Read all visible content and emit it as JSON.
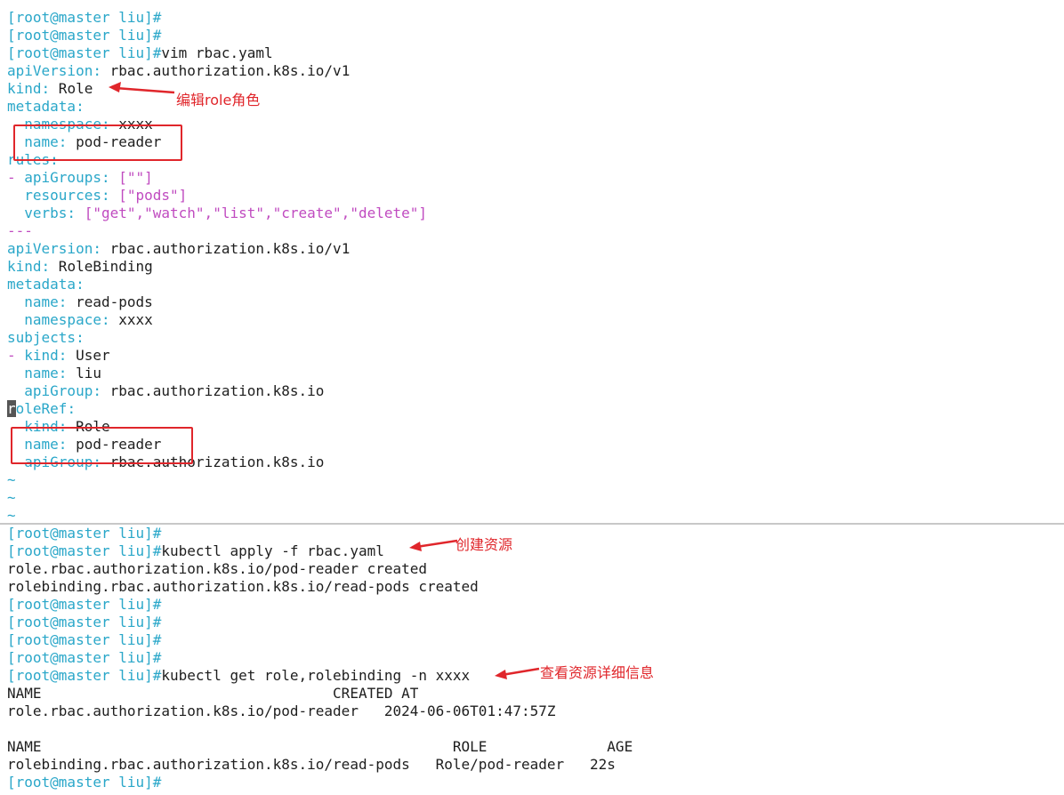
{
  "prompt": "[root@master liu]#",
  "editor": {
    "command": "vim rbac.yaml",
    "lines": {
      "l1_key": "apiVersion:",
      "l1_val": " rbac.authorization.k8s.io/v1",
      "l2_key": "kind:",
      "l2_val": " Role",
      "l3_key": "metadata:",
      "l4_key": "namespace:",
      "l4_val": " xxxx",
      "l5_key": "name:",
      "l5_val": " pod-reader",
      "l6_key": "rules:",
      "l7_dash": "- ",
      "l7_key": "apiGroups:",
      "l7_val": " [\"\"]",
      "l8_key": "resources:",
      "l8_val": " [\"pods\"]",
      "l9_key": "verbs:",
      "l9_val": " [\"get\",\"watch\",\"list\",\"create\",\"delete\"]",
      "l10": "---",
      "l11_key": "apiVersion:",
      "l11_val": " rbac.authorization.k8s.io/v1",
      "l12_key": "kind:",
      "l12_val": " RoleBinding",
      "l13_key": "metadata:",
      "l14_key": "name:",
      "l14_val": " read-pods",
      "l15_key": "namespace:",
      "l15_val": " xxxx",
      "l16_key": "subjects:",
      "l17_dash": "- ",
      "l17_key": "kind:",
      "l17_val": " User",
      "l18_key": "name:",
      "l18_val": " liu",
      "l19_key": "apiGroup:",
      "l19_val": " rbac.authorization.k8s.io",
      "l20_cursor": "r",
      "l20_key": "oleRef:",
      "l21_key": "kind:",
      "l21_val": " Role",
      "l22_key": "name:",
      "l22_val": " pod-reader",
      "l23_key": "apiGroup:",
      "l23_val": " rbac.authorization.k8s.io",
      "tilde": "~"
    }
  },
  "shell": {
    "apply_cmd": "kubectl apply -f rbac.yaml",
    "apply_out1": "role.rbac.authorization.k8s.io/pod-reader created",
    "apply_out2": "rolebinding.rbac.authorization.k8s.io/read-pods created",
    "get_cmd": "kubectl get role,rolebinding -n xxxx",
    "role_header": "NAME                                  CREATED AT",
    "role_row": "role.rbac.authorization.k8s.io/pod-reader   2024-06-06T01:47:57Z",
    "binding_header": "NAME                                                ROLE              AGE",
    "binding_row": "rolebinding.rbac.authorization.k8s.io/read-pods   Role/pod-reader   22s"
  },
  "annotations": {
    "edit_role": "编辑role角色",
    "create_resource": "创建资源",
    "view_details": "查看资源详细信息"
  },
  "colors": {
    "prompt": "#2aa7c9",
    "string": "#c04bc0",
    "annotation": "#e0262b"
  }
}
